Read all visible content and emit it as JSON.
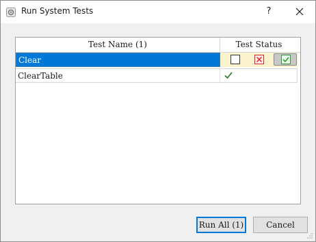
{
  "window": {
    "title": "Run System Tests",
    "help_label": "?"
  },
  "grid": {
    "columns": [
      "Test Name (1)",
      "Test Status"
    ],
    "rows": [
      {
        "name": "Clear",
        "status": "selected-choice",
        "selected": true
      },
      {
        "name": "ClearTable",
        "status": "passed"
      }
    ],
    "status_options": [
      "not-run",
      "failed",
      "passed"
    ]
  },
  "buttons": {
    "run_all": "Run All (1)",
    "cancel": "Cancel"
  },
  "colors": {
    "selection": "#0078d7",
    "status_cell_bg": "#fbf3cd",
    "fail_red": "#e02020",
    "pass_green": "#2a9d2a",
    "check_green": "#2b7a2b"
  }
}
